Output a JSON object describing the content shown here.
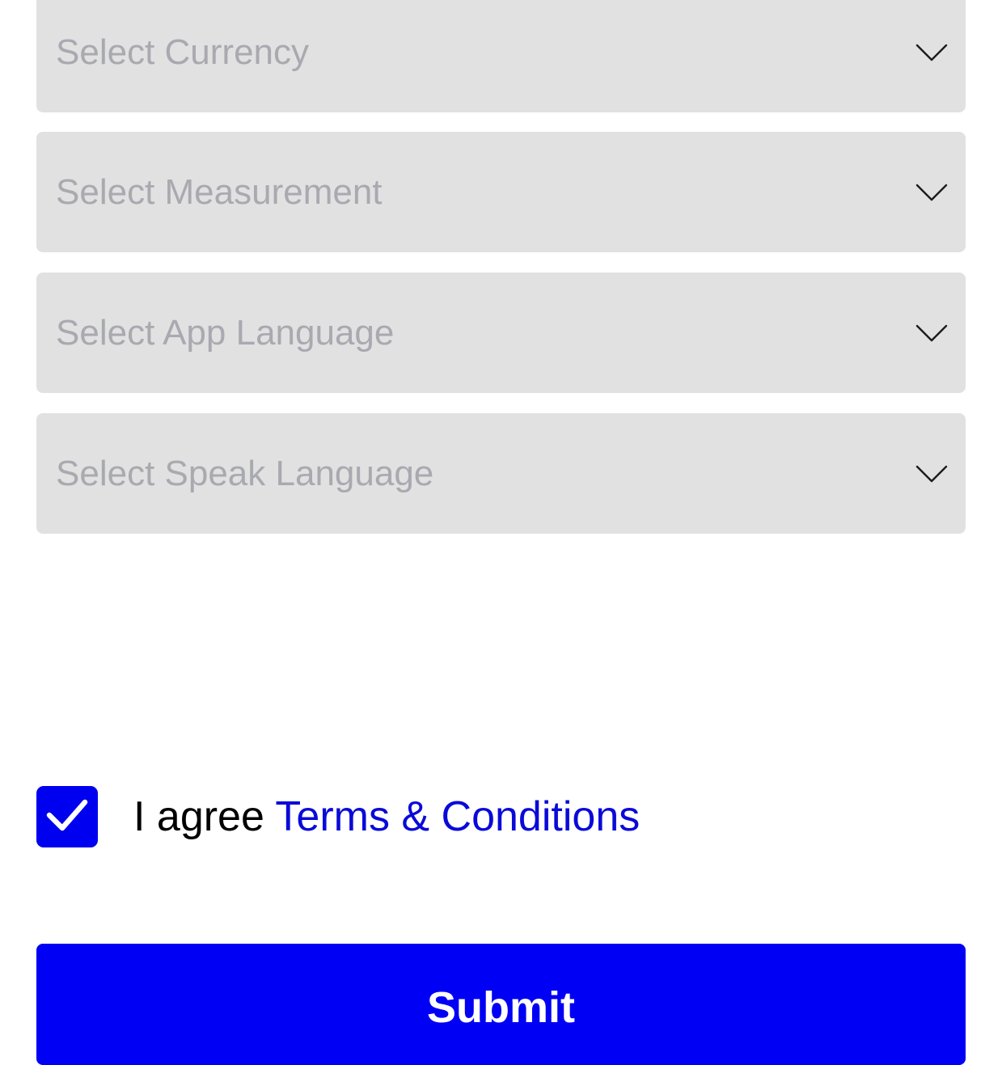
{
  "form": {
    "selects": [
      {
        "placeholder": "Select Currency",
        "icon": "chevron-down-icon"
      },
      {
        "placeholder": "Select Measurement",
        "icon": "chevron-down-icon"
      },
      {
        "placeholder": "Select App Language",
        "icon": "chevron-down-icon"
      },
      {
        "placeholder": "Select Speak Language",
        "icon": "chevron-down-icon"
      }
    ],
    "agree": {
      "checked": true,
      "prefix": "I agree",
      "link_text": "Terms & Conditions",
      "icon": "checkmark-icon"
    },
    "submit_label": "Submit"
  },
  "colors": {
    "select_background": "#e1e1e2",
    "placeholder_text": "#a9a9b0",
    "accent_blue": "#0000f5",
    "link_blue": "#0a0ad8"
  }
}
